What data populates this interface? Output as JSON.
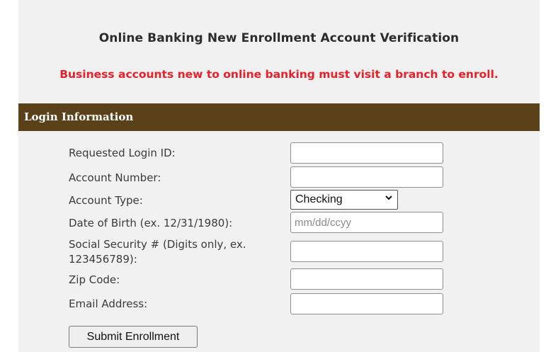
{
  "page": {
    "title": "Online Banking New Enrollment Account Verification",
    "warning": "Business accounts new to online banking must visit a branch to enroll."
  },
  "section": {
    "title": "Login Information"
  },
  "form": {
    "login_id": {
      "label": "Requested Login ID:",
      "value": ""
    },
    "account_number": {
      "label": "Account Number:",
      "value": ""
    },
    "account_type": {
      "label": "Account Type:",
      "selected": "Checking"
    },
    "dob": {
      "label": "Date of Birth (ex. 12/31/1980):",
      "placeholder": "mm/dd/ccyy",
      "value": ""
    },
    "ssn": {
      "label_line1": "Social Security # (Digits only, ex.",
      "label_line2": "123456789):",
      "value": ""
    },
    "zip": {
      "label": "Zip Code:",
      "value": ""
    },
    "email": {
      "label": "Email Address:",
      "value": ""
    },
    "submit_label": "Submit Enrollment"
  },
  "colors": {
    "section_bar": "#5b4119",
    "warning_text": "#e8202a"
  }
}
